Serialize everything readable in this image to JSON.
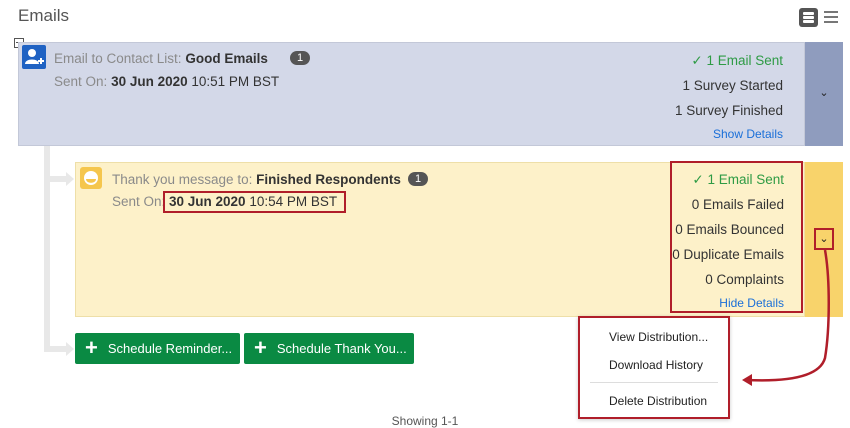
{
  "page": {
    "title": "Emails",
    "footer": "Showing 1-1"
  },
  "distribution1": {
    "label": "Email to Contact List:",
    "list_name": "Good Emails",
    "badge": "1",
    "sent_label": "Sent On:",
    "sent_date": "30 Jun 2020",
    "sent_time": "10:51 PM BST",
    "status_sent": "1 Email Sent",
    "surveys_started": "1 Survey Started",
    "surveys_finished": "1 Survey Finished",
    "details_link": "Show Details"
  },
  "distribution2": {
    "label": "Thank you message to:",
    "list_name": "Finished Respondents",
    "badge": "1",
    "sent_label": "Sent On:",
    "sent_date": "30 Jun 2020",
    "sent_time": "10:54 PM BST",
    "status_sent": "1 Email Sent",
    "failed": "0 Emails Failed",
    "bounced": "0 Emails Bounced",
    "duplicate": "0 Duplicate Emails",
    "complaints": "0 Complaints",
    "details_link": "Hide Details"
  },
  "actions": {
    "schedule_reminder": "Schedule Reminder...",
    "schedule_thank_you": "Schedule Thank You..."
  },
  "menu": {
    "view_distribution": "View Distribution...",
    "download_history": "Download History",
    "delete_distribution": "Delete Distribution"
  },
  "icons": {
    "check": "✓",
    "chevron": "⌄"
  },
  "colors": {
    "card1_bg": "#d3d8e8",
    "card2_bg": "#fdf1c9",
    "highlight": "#b01e2a",
    "button_green": "#0a8a43",
    "link_blue": "#1a6fd8",
    "sent_green": "#2e9b45"
  }
}
